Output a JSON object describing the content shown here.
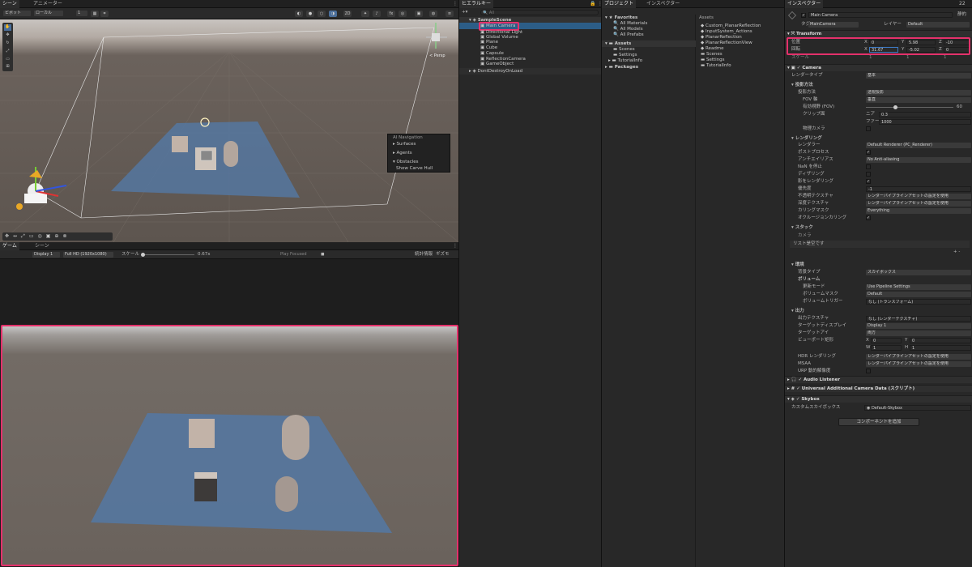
{
  "scene_view": {
    "tabs": [
      "シーン",
      "アニメーター"
    ],
    "toolbar": {
      "pivot": "ピボット",
      "space": "ローカル",
      "snap": "1",
      "persp": "< Persp"
    },
    "nav_overlay": {
      "title": "AI Navigation",
      "items": [
        "Surfaces",
        "Agents",
        "Obstacles",
        "Show Carve Hull"
      ]
    }
  },
  "game_view": {
    "tabs": [
      "ゲーム",
      "シーン"
    ],
    "display": "Display 1",
    "resolution": "Full HD (1920x1080)",
    "scale_label": "スケール",
    "scale_value": "0.67x",
    "play_focused": "Play Focused",
    "stats": "統計情報",
    "gizmos": "ギズモ"
  },
  "hierarchy": {
    "tab": "ヒエラルキー",
    "search_placeholder": "All",
    "scene": "SampleScene",
    "items": [
      "Main Camera",
      "Directional Light",
      "Global Volume",
      "Plane",
      "Cube",
      "Capsule",
      "ReflectionCamera",
      "GameObject"
    ],
    "dont_destroy": "DontDestroyOnLoad"
  },
  "project": {
    "tabs": [
      "プロジェクト",
      "インスペクター"
    ],
    "favorites": "Favorites",
    "fav_items": [
      "All Materials",
      "All Models",
      "All Prefabs"
    ],
    "assets": "Assets",
    "asset_folders": [
      "Scenes",
      "Settings",
      "TutorialInfo"
    ],
    "packages": "Packages",
    "assets_header": "Assets",
    "files": [
      "Custom_PlanarReflection",
      "InputSystem_Actions",
      "PlanarReflection",
      "PlanarReflectionView",
      "Readme",
      "Scenes",
      "Settings",
      "TutorialInfo"
    ]
  },
  "inspector": {
    "tab": "インスペクター",
    "count": "22",
    "static": "静的",
    "object_name": "Main Camera",
    "tag_label": "タグ",
    "tag": "MainCamera",
    "layer_label": "レイヤー",
    "layer": "Default",
    "transform": {
      "title": "Transform",
      "position_label": "位置",
      "pos": {
        "x": "0",
        "y": "5.98",
        "z": "-10"
      },
      "rotation_label": "回転",
      "rot": {
        "x": "31.67",
        "y": "-5.02",
        "z": "0"
      },
      "scale_label": "スケール",
      "scl": {
        "x": "1",
        "y": "1",
        "z": "1"
      }
    },
    "camera": {
      "title": "Camera",
      "render_type_label": "レンダータイプ",
      "render_type": "基本",
      "projection": "投影方法",
      "proj_method_label": "投影方法",
      "proj_method": "透視投影",
      "fov_axis_label": "FOV 軸",
      "fov_axis": "垂直",
      "fov_label": "有効視野 (FOV)",
      "fov": "60",
      "clip_label": "クリップ面",
      "near_label": "ニア",
      "near": "0.3",
      "far_label": "ファー",
      "far": "1000",
      "physical_label": "物理カメラ",
      "rendering": "レンダリング",
      "renderer_label": "レンダラー",
      "renderer": "Default Renderer (PC_Renderer)",
      "post_label": "ポストプロセス",
      "aa_label": "アンチエイリアス",
      "aa": "No Anti-aliasing",
      "nan_label": "NaN を停止",
      "dither_label": "ディザリング",
      "shadow_label": "影をレンダリング",
      "priority_label": "優先度",
      "priority": "-1",
      "opaque_label": "不透明テクスチャ",
      "opaque": "レンダーパイプラインアセットの設定を使用",
      "depth_label": "深度テクスチャ",
      "depth": "レンダーパイプラインアセットの設定を使用",
      "culling_label": "カリングマスク",
      "culling": "Everything",
      "occlusion_label": "オクルージョンカリング",
      "stack": "スタック",
      "stack_camera": "カメラ",
      "stack_empty": "リスト是空です",
      "environment": "環境",
      "bg_label": "背景タイプ",
      "bg": "スカイボックス",
      "volumes": "ボリューム",
      "update_label": "更新モード",
      "update": "Use Pipeline Settings",
      "vmask_label": "ボリュームマスク",
      "vmask": "Default",
      "vtrigger_label": "ボリュームトリガー",
      "vtrigger": "なし (トランスフォーム)",
      "output": "出力",
      "out_tex_label": "出力テクスチャ",
      "out_tex": "なし (レンダーテクスチャ)",
      "target_display_label": "ターゲットディスプレイ",
      "target_display": "Display 1",
      "target_eye_label": "ターゲットアイ",
      "target_eye": "両方",
      "viewport_label": "ビューポート矩形",
      "vp": {
        "x": "0",
        "y": "0",
        "w": "1",
        "h": "1"
      },
      "hdr_label": "HDR レンダリング",
      "hdr": "レンダーパイプラインアセットの設定を使用",
      "msaa_label": "MSAA",
      "msaa": "レンダーパイプラインアセットの設定を使用",
      "urp_label": "URP 動的解像度"
    },
    "audio_listener": "Audio Listener",
    "uacd": "Universal Additional Camera Data (スクリプト)",
    "skybox": {
      "title": "Skybox",
      "label": "カスタムスカイボックス",
      "value": "Default-Skybox"
    },
    "add_component": "コンポーネントを追加"
  },
  "colors": {
    "highlight": "#e4316b",
    "selection": "#2c5d87",
    "floor": "#5577a0"
  }
}
